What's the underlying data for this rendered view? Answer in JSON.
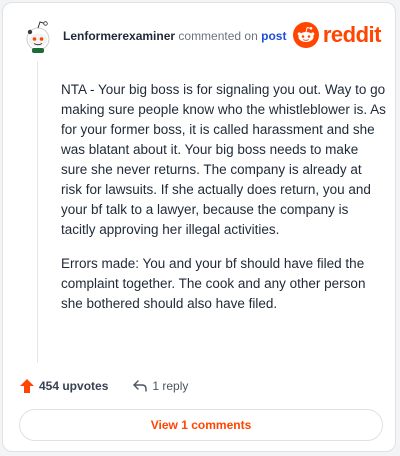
{
  "comment": {
    "username": "Lenformerexaminer",
    "action_text": "commented on",
    "post_link": "post",
    "paragraphs": [
      "NTA - Your big boss is for signaling you out. Way to go making sure people know who the whistleblower is. As for your former boss, it is called harassment and she was blatant about it. Your big boss needs to make sure she never returns. The company is already at risk for lawsuits. If she actually does return, you and your bf talk to a lawyer, because the company is tacitly approving her illegal activities.",
      "Errors made: You and your bf should have filed the complaint together. The cook and any other person she bothered should also have filed."
    ]
  },
  "brand": {
    "name": "reddit",
    "icon": "reddit-logo-icon",
    "color": "#ff4500"
  },
  "actions": {
    "upvotes_label": "454 upvotes",
    "reply_label": "1 reply",
    "upvote_icon": "upvote-arrow-icon",
    "reply_icon": "reply-arrow-icon"
  },
  "view_button": {
    "label": "View 1 comments"
  }
}
